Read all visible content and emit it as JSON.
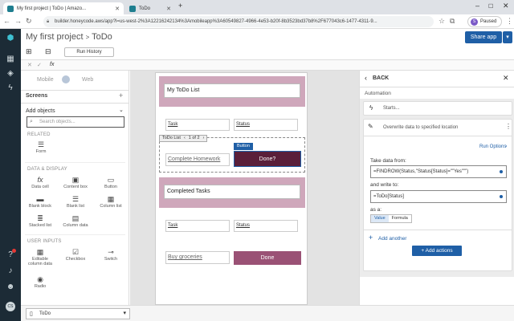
{
  "browser": {
    "tabs": [
      {
        "label": "My first project | ToDo | Amazo..."
      },
      {
        "label": "ToDo"
      }
    ],
    "url": "builder.honeycode.aws/app?l=us-west-2%3A12216242134%3Amobileapp%3A60549827-4966-4e53-b20f-8b3523bd37b8%2F677043c6-1477-4311-9...",
    "paused_label": "Paused",
    "profile_initial": "S"
  },
  "header": {
    "project": "My first project",
    "separator": ">",
    "screen": "ToDo",
    "share_label": "Share app"
  },
  "toolbar": {
    "run_history": "Run History"
  },
  "formula": {
    "fx": "fx"
  },
  "left_panel": {
    "mode_mobile": "Mobile",
    "mode_web": "Web",
    "screens_label": "Screens",
    "add_objects_label": "Add objects",
    "search_placeholder": "Search objects...",
    "related_label": "RELATED",
    "data_display_label": "DATA & DISPLAY",
    "user_inputs_label": "USER INPUTS",
    "related_items": [
      {
        "label": "Form"
      }
    ],
    "data_items": [
      {
        "label": "Data cell"
      },
      {
        "label": "Content box"
      },
      {
        "label": "Button"
      },
      {
        "label": "Blank block"
      },
      {
        "label": "Blank list"
      },
      {
        "label": "Column list"
      },
      {
        "label": "Stacked list"
      },
      {
        "label": "Column data"
      }
    ],
    "input_items": [
      {
        "label": "Editable column data"
      },
      {
        "label": "Checkbox"
      },
      {
        "label": "Switch"
      },
      {
        "label": "Radio"
      }
    ]
  },
  "canvas": {
    "title1": "My ToDo List",
    "task_header": "Task",
    "status_header": "Status",
    "list_label": "ToDo List",
    "pager": "1 of 2",
    "button_tag": "Button",
    "item1": "Complete Homework",
    "done_label": "Done?",
    "title2": "Completed Tasks",
    "task_header2": "Task",
    "status_header2": "Status",
    "item2": "Buy groceries",
    "done_label2": "Done"
  },
  "right_panel": {
    "back_label": "BACK",
    "section": "Automation",
    "starts": "Starts...",
    "action_title": "Overwrite data to specified location",
    "run_options": "Run Options",
    "take_data_label": "Take data from:",
    "take_data_value": "=FINDROW(Status,\"Status[Status]=\"\"Yes\"\"\")",
    "write_to_label": "and write to:",
    "write_to_value": "=ToDo[Status]",
    "as_a_label": "as a:",
    "as_value": "Value",
    "as_formula": "Formula",
    "add_another": "Add another",
    "add_actions": "Add actions"
  },
  "bottom": {
    "screen_select": "ToDo"
  },
  "colors": {
    "accent": "#1f5fa6",
    "pink": "#cfa7bb",
    "plum": "#7b3558",
    "nav": "#1c2b36"
  }
}
